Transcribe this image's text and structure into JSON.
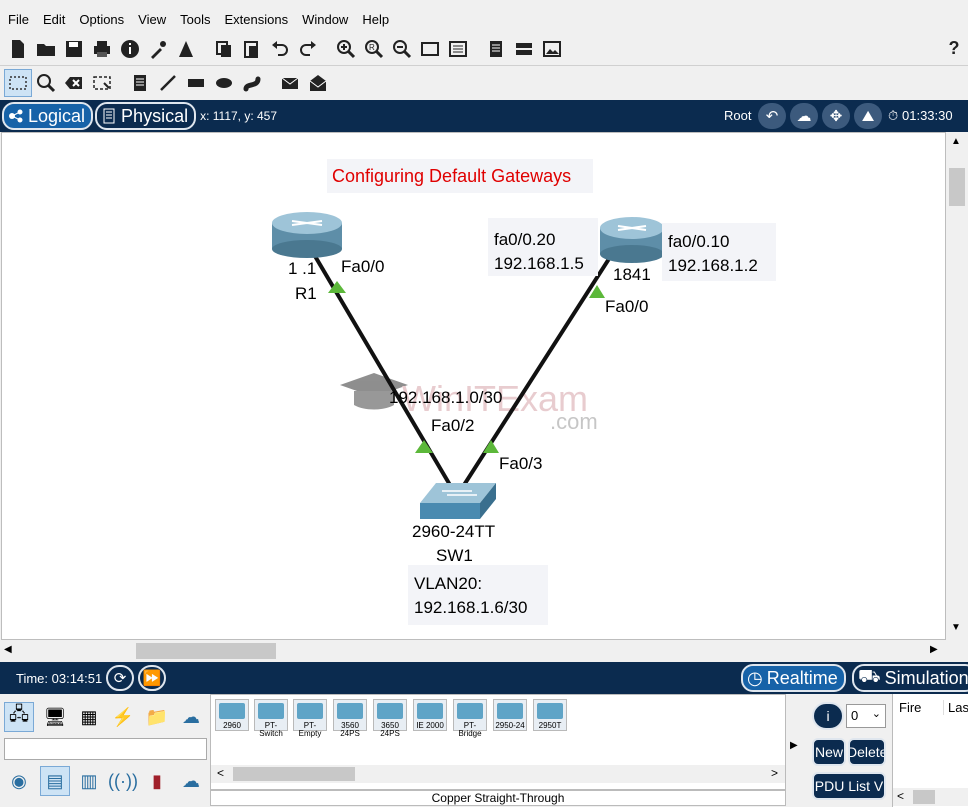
{
  "menu": [
    "File",
    "Edit",
    "Options",
    "View",
    "Tools",
    "Extensions",
    "Window",
    "Help"
  ],
  "help_symbol": "?",
  "tabs": {
    "logical": "Logical",
    "physical": "Physical"
  },
  "coords": "x: 1117, y: 457",
  "root_label": "Root",
  "clock": "01:33:30",
  "canvas": {
    "title": "Configuring Default Gateways",
    "r1_model": "1  .1",
    "r1_name": "R1",
    "r1_port": "Fa0/0",
    "r2_model": "1841",
    "r2_port": "Fa0/0",
    "r2_sub20_name": "fa0/0.20",
    "r2_sub20_ip": "192.168.1.5",
    "r2_sub10_name": "fa0/0.10",
    "r2_sub10_ip": "192.168.1.2",
    "link_net": "192.168.1.0/30",
    "sw_port_r1": "Fa0/2",
    "sw_port_r2": "Fa0/3",
    "sw_model": "2960-24TT",
    "sw_name": "SW1",
    "vlan_line1": "VLAN20:",
    "vlan_line2": "192.168.1.6/30",
    "watermark_main": "WinITExam",
    "watermark_sub": ".com"
  },
  "time_label": "Time: 03:14:51",
  "modes": {
    "realtime": "Realtime",
    "simulation": "Simulation"
  },
  "devices": [
    "2960",
    "PT-Switch",
    "PT-Empty",
    "3560 24PS",
    "3650 24PS",
    "IE 2000",
    "PT-Bridge",
    "2950-24",
    "2950T"
  ],
  "connection_label": "Copper Straight-Through",
  "pdu": {
    "select_value": "0",
    "new": "New",
    "delete": "Delete",
    "list": "PDU List V"
  },
  "columns": {
    "fire": "Fire",
    "last": "Last"
  },
  "colors": {
    "title_red": "#e00000",
    "link_green": "#5cb83a",
    "bar_navy": "#0b2b4f"
  }
}
